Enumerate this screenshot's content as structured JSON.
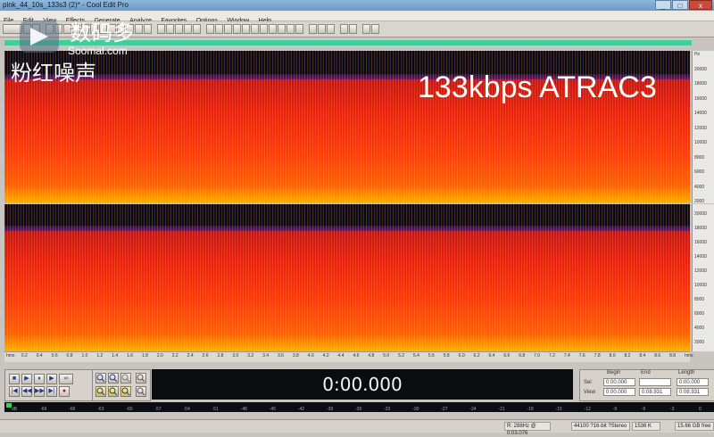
{
  "window": {
    "title": "pink_44_10s_133s3 (2)* - Cool Edit Pro",
    "buttons": {
      "minimize": "_",
      "maximize": "□",
      "close": "x"
    }
  },
  "menu": [
    "File",
    "Edit",
    "View",
    "Effects",
    "Generate",
    "Analyze",
    "Favorites",
    "Options",
    "Window",
    "Help"
  ],
  "watermark": {
    "site_cn": "数码多",
    "site_en": "Soomal.com",
    "label_cn": "粉红噪声"
  },
  "codec_label": "133kbps ATRAC3",
  "freq_ruler": {
    "top_ticks": [
      "Hz",
      "20000",
      "18000",
      "16000",
      "14000",
      "12000",
      "10000",
      "8000",
      "6000",
      "4000",
      "2000"
    ],
    "bottom_ticks": [
      "20000",
      "18000",
      "16000",
      "14000",
      "12000",
      "10000",
      "8000",
      "6000",
      "4000",
      "2000"
    ]
  },
  "time_ruler": [
    "hms",
    "0.2",
    "0.4",
    "0.6",
    "0.8",
    "1.0",
    "1.2",
    "1.4",
    "1.6",
    "1.8",
    "2.0",
    "2.2",
    "2.4",
    "2.6",
    "2.8",
    "3.0",
    "3.2",
    "3.4",
    "3.6",
    "3.8",
    "4.0",
    "4.2",
    "4.4",
    "4.6",
    "4.8",
    "5.0",
    "5.2",
    "5.4",
    "5.6",
    "5.8",
    "6.0",
    "6.2",
    "6.4",
    "6.6",
    "6.8",
    "7.0",
    "7.2",
    "7.4",
    "7.6",
    "7.8",
    "8.0",
    "8.2",
    "8.4",
    "8.6",
    "8.8",
    "hms"
  ],
  "transport": {
    "row1": [
      "■",
      "▶",
      "⏸",
      "▶",
      "∞"
    ],
    "row2": [
      "|◀",
      "◀◀",
      "▶▶",
      "▶|",
      "●"
    ]
  },
  "time_display": "0:00.000",
  "selection": {
    "headers": [
      "Begin",
      "End",
      "Length"
    ],
    "rows": [
      {
        "label": "Sel",
        "values": [
          "0:00.000",
          "",
          "0:00.000"
        ]
      },
      {
        "label": "View",
        "values": [
          "0:00.000",
          "0:08.931",
          "0:08.931"
        ]
      }
    ]
  },
  "level_ticks": [
    "dB",
    "-69",
    "-66",
    "-63",
    "-60",
    "-57",
    "-54",
    "-51",
    "-48",
    "-45",
    "-42",
    "-39",
    "-36",
    "-33",
    "-30",
    "-27",
    "-24",
    "-21",
    "-18",
    "-15",
    "-12",
    "-9",
    "-6",
    "-3",
    "0"
  ],
  "status": {
    "cursor": "R: 288Hz @ 0:03.076",
    "format": "44100 ?16-bit ?Stereo",
    "size": "1536 K",
    "free": "15.66 GB free"
  },
  "colors": {
    "spectrum_dark": "#05081a",
    "spectrum_hot": "#ff2a0e",
    "spectrum_warm": "#ff8a00",
    "track_green": "#3ecf9f"
  }
}
